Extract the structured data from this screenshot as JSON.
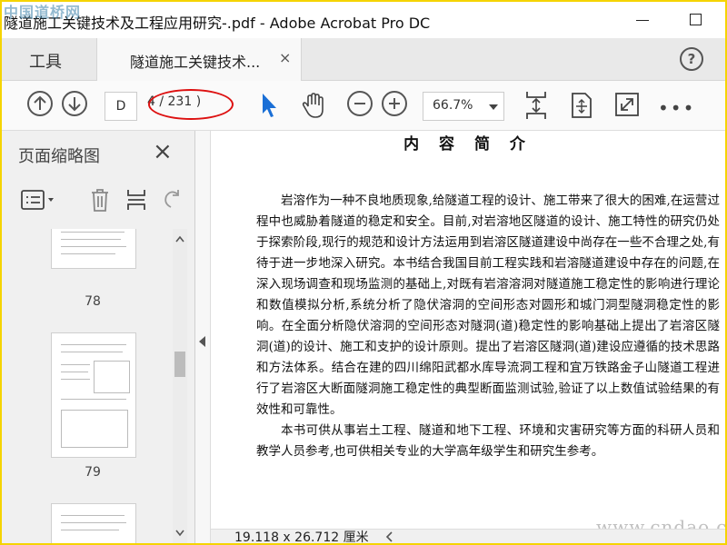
{
  "window": {
    "title": "隧道施工关键技术及工程应用研究-.pdf - Adobe Acrobat Pro DC",
    "watermark_top": "中国道桥网"
  },
  "tabs": {
    "tools_label": "工具",
    "doc_label": "隧道施工关键技术...",
    "close_glyph": "×",
    "help_glyph": "?"
  },
  "toolbar": {
    "page_input": "D",
    "page_count": "4 / 231 )",
    "zoom": "66.7%",
    "more_glyph": "•••"
  },
  "thumbnails": {
    "title": "页面缩略图",
    "close_glyph": "×",
    "pages": [
      "78",
      "79"
    ]
  },
  "document": {
    "heading": "内 容 简 介",
    "paragraphs": [
      "岩溶作为一种不良地质现象,给隧道工程的设计、施工带来了很大的困难,在运营过程中也威胁着隧道的稳定和安全。目前,对岩溶地区隧道的设计、施工特性的研究仍处于探索阶段,现行的规范和设计方法运用到岩溶区隧道建设中尚存在一些不合理之处,有待于进一步地深入研究。本书结合我国目前工程实践和岩溶隧道建设中存在的问题,在深入现场调查和现场监测的基础上,对既有岩溶溶洞对隧道施工稳定性的影响进行理论和数值模拟分析,系统分析了隐伏溶洞的空间形态对圆形和城门洞型隧洞稳定性的影响。在全面分析隐伏溶洞的空间形态对隧洞(道)稳定性的影响基础上提出了岩溶区隧洞(道)的设计、施工和支护的设计原则。提出了岩溶区隧洞(道)建设应遵循的技术思路和方法体系。结合在建的四川绵阳武都水库导流洞工程和宜万铁路金子山隧道工程进行了岩溶区大断面隧洞施工稳定性的典型断面监测试验,验证了以上数值试验结果的有效性和可靠性。",
      "本书可供从事岩土工程、隧道和地下工程、环境和灾害研究等方面的科研人员和教学人员参考,也可供相关专业的大学高年级学生和研究生参考。"
    ],
    "page_size": "19.118 x 26.712 厘米",
    "watermark_bottom": "www.cndao.com"
  },
  "colors": {
    "frame": "#f5d400",
    "accent_cursor": "#1a6fd6",
    "annotation_ring": "#dd1111"
  }
}
